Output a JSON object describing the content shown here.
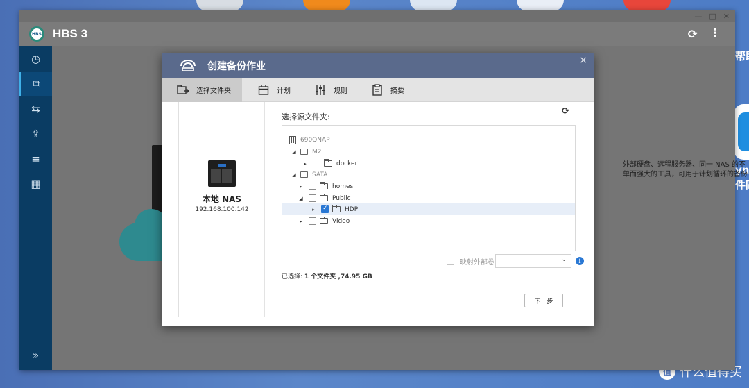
{
  "desktop": {
    "right_labels": [
      "帮助",
      "ync",
      "件同"
    ],
    "watermark": "什么值得买",
    "watermark_icon": "值"
  },
  "window": {
    "controls": [
      "—",
      "□",
      "✕"
    ]
  },
  "app": {
    "title": "HBS 3",
    "logo_text": "HBS",
    "refresh_icon": "⟳",
    "more_icon": "⋮",
    "sidebar": {
      "items": [
        {
          "icon": "dashboard-icon",
          "glyph": "◷"
        },
        {
          "icon": "backup-icon",
          "glyph": "⧉"
        },
        {
          "icon": "sync-icon",
          "glyph": "⇆"
        },
        {
          "icon": "restore-icon",
          "glyph": "⇪"
        },
        {
          "icon": "storage-icon",
          "glyph": "≡"
        },
        {
          "icon": "services-icon",
          "glyph": "▦"
        }
      ],
      "expand": "»"
    },
    "background_text": [
      "外部硬盘、远程服务器、同一 NAS 的不",
      "单而强大的工具，可用于计划循环的备份"
    ]
  },
  "dialog": {
    "title": "创建备份作业",
    "close": "×",
    "steps": [
      {
        "label": "选择文件夹",
        "icon": "folder-select-icon",
        "active": true
      },
      {
        "label": "计划",
        "icon": "calendar-icon",
        "active": false
      },
      {
        "label": "规则",
        "icon": "rules-sliders-icon",
        "active": false
      },
      {
        "label": "摘要",
        "icon": "summary-clipboard-icon",
        "active": false
      }
    ],
    "local_nas": {
      "name": "本地 NAS",
      "ip": "192.168.100.142"
    },
    "source_label": "选择源文件夹:",
    "refresh": "⟳",
    "tree": {
      "root": "690QNAP",
      "m2": "M2",
      "docker": "docker",
      "sata": "SATA",
      "homes": "homes",
      "public": "Public",
      "hdp": "HDP",
      "video": "Video"
    },
    "map_external_label": "映射外部卷",
    "info": "i",
    "selected_prefix": "已选择: ",
    "selected_count": "1 个文件夹",
    "selected_size": " ,74.95 GB",
    "next_button": "下一步"
  }
}
